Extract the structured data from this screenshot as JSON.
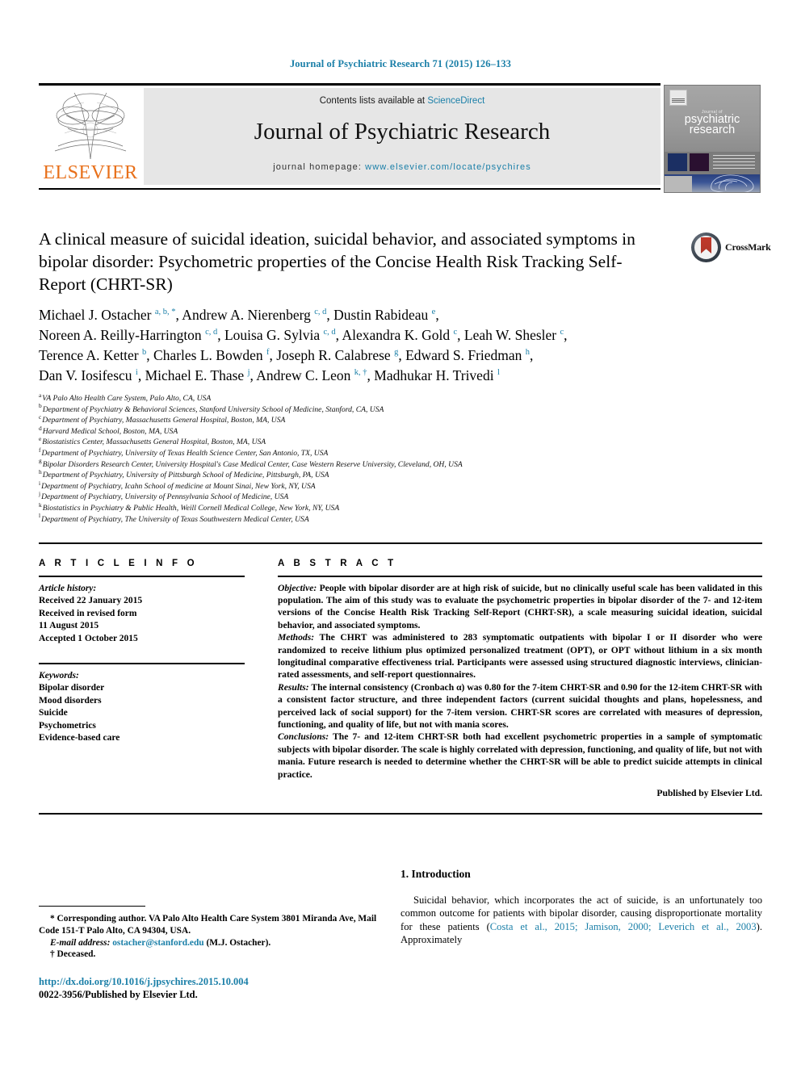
{
  "running_head": "Journal of Psychiatric Research 71 (2015) 126–133",
  "masthead": {
    "contents_prefix": "Contents lists available at ",
    "sciencedirect": "ScienceDirect",
    "journal_title": "Journal of Psychiatric Research",
    "homepage_prefix": "journal homepage: ",
    "homepage_url": "www.elsevier.com/locate/psychires",
    "publisher": "ELSEVIER",
    "cover": {
      "kicker": "Journal of",
      "title_line1": "psychiatric",
      "title_line2": "research"
    },
    "accent_color": "#1a7fa8",
    "publisher_color": "#E8701A"
  },
  "crossmark": {
    "label": "CrossMark"
  },
  "article": {
    "title": "A clinical measure of suicidal ideation, suicidal behavior, and associated symptoms in bipolar disorder: Psychometric properties of the Concise Health Risk Tracking Self-Report (CHRT-SR)",
    "authors_line1_html": "Michael J. Ostacher <sup>a, b, *</sup>, Andrew A. Nierenberg <sup>c, d</sup>, Dustin Rabideau <sup>e</sup>,",
    "authors_line2_html": "Noreen A. Reilly-Harrington <sup>c, d</sup>, Louisa G. Sylvia <sup>c, d</sup>, Alexandra K. Gold <sup>c</sup>, Leah W. Shesler <sup>c</sup>,",
    "authors_line3_html": "Terence A. Ketter <sup>b</sup>, Charles L. Bowden <sup>f</sup>, Joseph R. Calabrese <sup>g</sup>, Edward S. Friedman <sup>h</sup>,",
    "authors_line4_html": "Dan V. Iosifescu <sup>i</sup>, Michael E. Thase <sup>j</sup>, Andrew C. Leon <sup>k, †</sup>, Madhukar H. Trivedi <sup>l</sup>",
    "affiliations": [
      {
        "mark": "a",
        "text": "VA Palo Alto Health Care System, Palo Alto, CA, USA"
      },
      {
        "mark": "b",
        "text": "Department of Psychiatry & Behavioral Sciences, Stanford University School of Medicine, Stanford, CA, USA"
      },
      {
        "mark": "c",
        "text": "Department of Psychiatry, Massachusetts General Hospital, Boston, MA, USA"
      },
      {
        "mark": "d",
        "text": "Harvard Medical School, Boston, MA, USA"
      },
      {
        "mark": "e",
        "text": "Biostatistics Center, Massachusetts General Hospital, Boston, MA, USA"
      },
      {
        "mark": "f",
        "text": "Department of Psychiatry, University of Texas Health Science Center, San Antonio, TX, USA"
      },
      {
        "mark": "g",
        "text": "Bipolar Disorders Research Center, University Hospital's Case Medical Center, Case Western Reserve University, Cleveland, OH, USA"
      },
      {
        "mark": "h",
        "text": "Department of Psychiatry, University of Pittsburgh School of Medicine, Pittsburgh, PA, USA"
      },
      {
        "mark": "i",
        "text": "Department of Psychiatry, Icahn School of medicine at Mount Sinai, New York, NY, USA"
      },
      {
        "mark": "j",
        "text": "Department of Psychiatry, University of Pennsylvania School of Medicine, USA"
      },
      {
        "mark": "k",
        "text": "Biostatistics in Psychiatry & Public Health, Weill Cornell Medical College, New York, NY, USA"
      },
      {
        "mark": "l",
        "text": "Department of Psychiatry, The University of Texas Southwestern Medical Center, USA"
      }
    ]
  },
  "article_info": {
    "heading": "A R T I C L E   I N F O",
    "history_label": "Article history:",
    "history_lines": [
      "Received 22 January 2015",
      "Received in revised form",
      "11 August 2015",
      "Accepted 1 October 2015"
    ],
    "keywords_label": "Keywords:",
    "keywords": [
      "Bipolar disorder",
      "Mood disorders",
      "Suicide",
      "Psychometrics",
      "Evidence-based care"
    ]
  },
  "abstract": {
    "heading": "A B S T R A C T",
    "objective_label": "Objective:",
    "objective_text": " People with bipolar disorder are at high risk of suicide, but no clinically useful scale has been validated in this population. The aim of this study was to evaluate the psychometric properties in bipolar disorder of the 7- and 12-item versions of the Concise Health Risk Tracking Self-Report (CHRT-SR), a scale measuring suicidal ideation, suicidal behavior, and associated symptoms.",
    "methods_label": "Methods:",
    "methods_text": " The CHRT was administered to 283 symptomatic outpatients with bipolar I or II disorder who were randomized to receive lithium plus optimized personalized treatment (OPT), or OPT without lithium in a six month longitudinal comparative effectiveness trial. Participants were assessed using structured diagnostic interviews, clinician-rated assessments, and self-report questionnaires.",
    "results_label": "Results:",
    "results_text": " The internal consistency (Cronbach α) was 0.80 for the 7-item CHRT-SR and 0.90 for the 12-item CHRT-SR with a consistent factor structure, and three independent factors (current suicidal thoughts and plans, hopelessness, and perceived lack of social support) for the 7-item version. CHRT-SR scores are correlated with measures of depression, functioning, and quality of life, but not with mania scores.",
    "conclusions_label": "Conclusions:",
    "conclusions_text": " The 7- and 12-item CHRT-SR both had excellent psychometric properties in a sample of symptomatic subjects with bipolar disorder. The scale is highly correlated with depression, functioning, and quality of life, but not with mania. Future research is needed to determine whether the CHRT-SR will be able to predict suicide attempts in clinical practice.",
    "credit": "Published by Elsevier Ltd."
  },
  "introduction": {
    "heading": "1. Introduction",
    "paragraph_prefix": "Suicidal behavior, which incorporates the act of suicide, is an unfortunately too common outcome for patients with bipolar disorder, causing disproportionate mortality for these patients (",
    "citations": "Costa et al., 2015; Jamison, 2000; Leverich et al., 2003",
    "paragraph_suffix": "). Approximately"
  },
  "footnotes": {
    "corresponding_marker": "*",
    "corresponding_text": " Corresponding author. VA Palo Alto Health Care System 3801 Miranda Ave, Mail Code 151-T Palo Alto, CA 94304, USA.",
    "email_label": "E-mail address:",
    "email": "ostacher@stanford.edu",
    "email_suffix": " (M.J. Ostacher).",
    "deceased_marker": "†",
    "deceased_text": " Deceased."
  },
  "footer": {
    "doi": "http://dx.doi.org/10.1016/j.jpsychires.2015.10.004",
    "issn_line": "0022-3956/Published by Elsevier Ltd."
  }
}
